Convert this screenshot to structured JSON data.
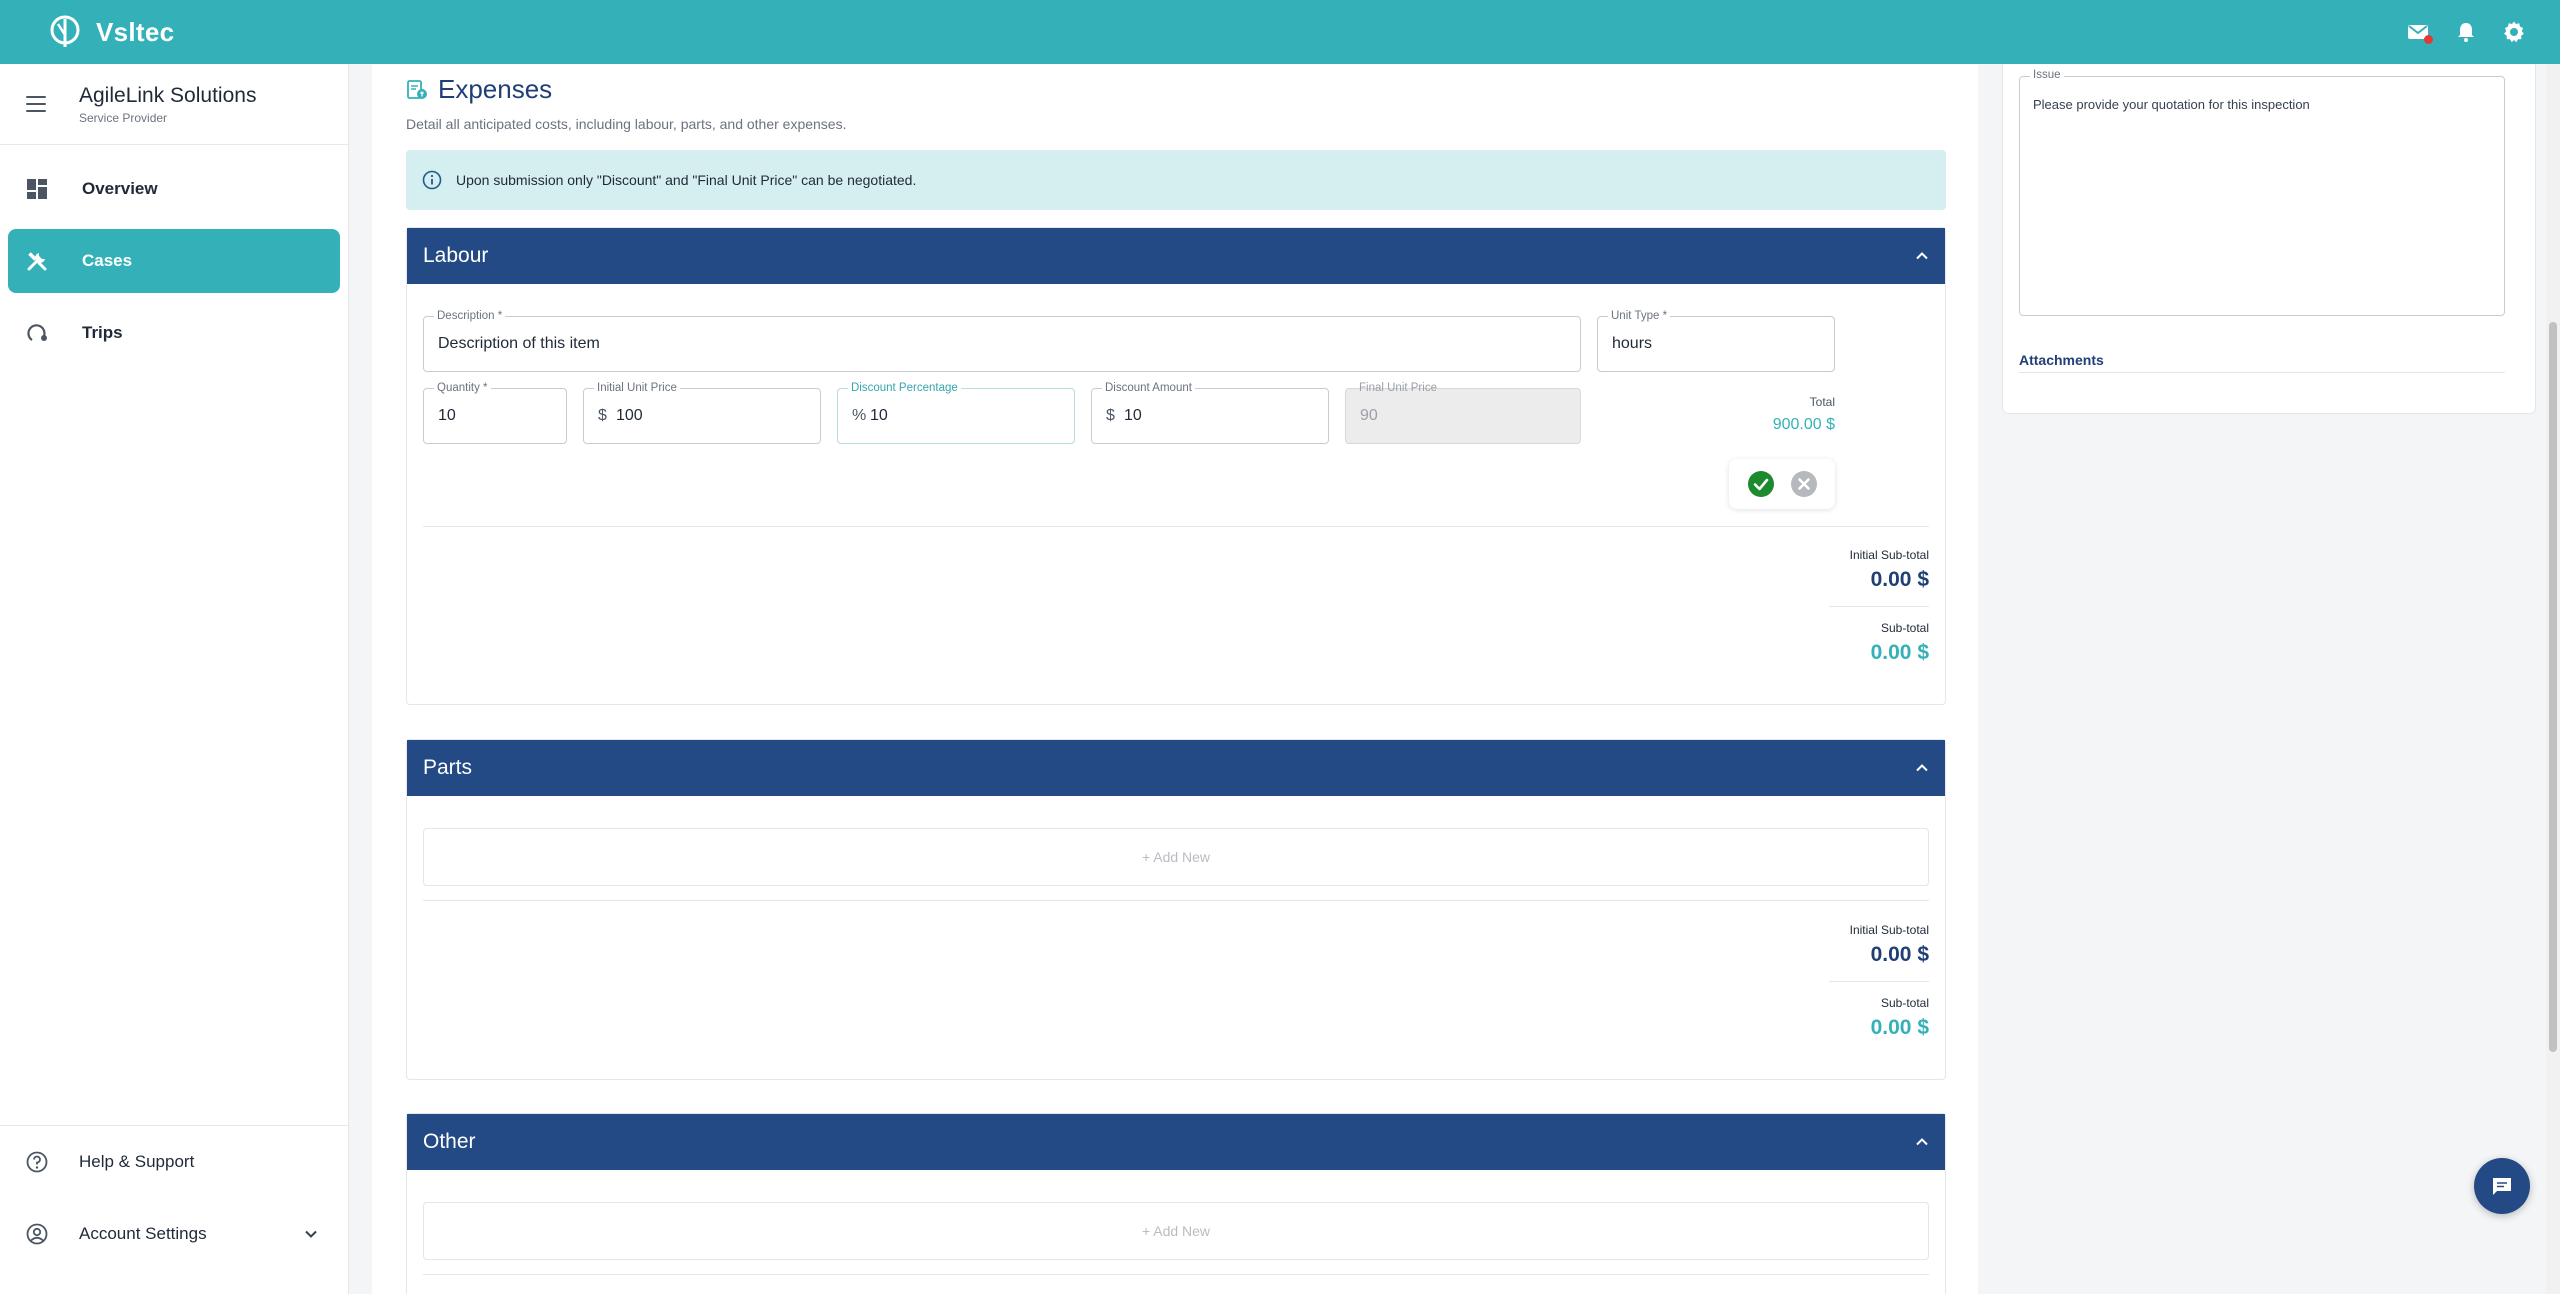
{
  "app": {
    "name": "Vsltec"
  },
  "topbar": {
    "icons": [
      "mail-icon",
      "bell-icon",
      "gear-icon"
    ]
  },
  "sidebar": {
    "company_name": "AgileLink Solutions",
    "company_role": "Service Provider",
    "items": [
      {
        "label": "Overview",
        "icon": "dashboard-icon",
        "active": false
      },
      {
        "label": "Cases",
        "icon": "tools-icon",
        "active": true
      },
      {
        "label": "Trips",
        "icon": "route-icon",
        "active": false
      }
    ],
    "bottom": [
      {
        "label": "Help & Support",
        "icon": "help-icon"
      },
      {
        "label": "Account Settings",
        "icon": "account-icon"
      }
    ]
  },
  "expenses": {
    "title": "Expenses",
    "subtitle": "Detail all anticipated costs, including labour, parts, and other expenses.",
    "info": "Upon submission only \"Discount\" and \"Final Unit Price\" can be negotiated."
  },
  "labour": {
    "title": "Labour",
    "form": {
      "description_label": "Description *",
      "description_value": "Description of this item",
      "unit_type_label": "Unit Type *",
      "unit_type_value": "hours",
      "quantity_label": "Quantity *",
      "quantity_value": "10",
      "initial_unit_price_label": "Initial Unit Price",
      "initial_unit_price_prefix": "$",
      "initial_unit_price_value": "100",
      "discount_pct_label": "Discount Percentage",
      "discount_pct_prefix": "%",
      "discount_pct_value": "10",
      "discount_amount_label": "Discount Amount",
      "discount_amount_prefix": "$",
      "discount_amount_value": "10",
      "final_unit_price_label": "Final Unit Price",
      "final_unit_price_value": "90",
      "total_label": "Total",
      "total_value": "900.00 $"
    },
    "initial_subtotal_label": "Initial Sub-total",
    "initial_subtotal_value": "0.00 $",
    "subtotal_label": "Sub-total",
    "subtotal_value": "0.00 $"
  },
  "parts": {
    "title": "Parts",
    "add_new": "+ Add New",
    "initial_subtotal_label": "Initial Sub-total",
    "initial_subtotal_value": "0.00 $",
    "subtotal_label": "Sub-total",
    "subtotal_value": "0.00 $"
  },
  "other": {
    "title": "Other",
    "add_new": "+ Add New"
  },
  "right_panel": {
    "issue_label": "Issue",
    "issue_text": "Please provide your quotation for this inspection",
    "attachments_title": "Attachments"
  },
  "colors": {
    "brand_teal": "#34b1b8",
    "section_navy": "#234a85",
    "confirm_green": "#1e8a2e"
  }
}
